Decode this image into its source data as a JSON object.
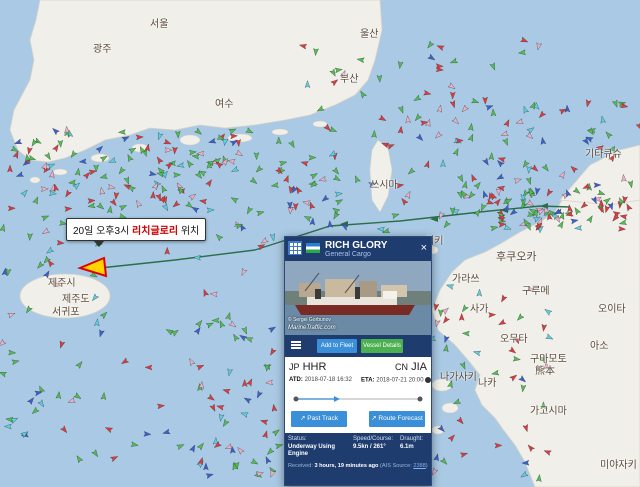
{
  "map": {
    "labels": [
      {
        "id": "gwangju",
        "text": "광주"
      },
      {
        "id": "seoul",
        "text": "서울"
      },
      {
        "id": "busan",
        "text": "부산"
      },
      {
        "id": "ulsan",
        "text": "울산"
      },
      {
        "id": "yeosu",
        "text": "여수"
      },
      {
        "id": "jeju",
        "text": "제주도"
      },
      {
        "id": "seogwipo",
        "text": "서귀포"
      },
      {
        "id": "jejusi",
        "text": "제주시"
      },
      {
        "id": "fukuoka",
        "text": "후쿠오카"
      },
      {
        "id": "kumamoto_ko",
        "text": "구마모토"
      },
      {
        "id": "kumamoto_jp",
        "text": "熊本"
      },
      {
        "id": "miyazaki",
        "text": "미야자키"
      },
      {
        "id": "nagasaki",
        "text": "나가사키"
      },
      {
        "id": "saga",
        "text": "사가"
      },
      {
        "id": "karatsu",
        "text": "가라쓰"
      },
      {
        "id": "kitakyushu",
        "text": "기타큐슈"
      },
      {
        "id": "oita",
        "text": "오이타"
      },
      {
        "id": "kagoshima",
        "text": "가고시마"
      },
      {
        "id": "kurume",
        "text": "구루메"
      },
      {
        "id": "omuta",
        "text": "오무타"
      },
      {
        "id": "naka",
        "text": "나카"
      },
      {
        "id": "iki",
        "text": "이키"
      },
      {
        "id": "aso",
        "text": "아소"
      },
      {
        "id": "tsushima",
        "text": "쓰시마"
      }
    ]
  },
  "callout": {
    "prefix": "20일 오후3시 ",
    "ship": "리치글로리",
    "suffix": " 위치"
  },
  "panel": {
    "vessel_name": "RICH GLORY",
    "vessel_type": "General Cargo",
    "close_icon": "×",
    "photo_credit": "© Sergei Gorbunov",
    "photo_site": "MarineTraffic.com",
    "add_fleet": "Add to Fleet",
    "vessel_details": "Vessel Details",
    "from_country": "JP",
    "from_port": "HHR",
    "to_country": "CN",
    "to_port": "JIA",
    "atd_label": "ATD:",
    "atd_value": "2018-07-18 16:32",
    "eta_label": "ETA:",
    "eta_value": "2018-07-21 20:00",
    "progress": 0.33,
    "past_track": "Past Track",
    "route_forecast": "Route Forecast",
    "status_label": "Status:",
    "status_value": "Underway Using Engine",
    "speed_label": "Speed/Course:",
    "speed_value": "9.5kn / 261°",
    "draught_label": "Draught:",
    "draught_value": "6.1m",
    "received_label": "Received:",
    "received_value": "3 hours, 19 minutes ago",
    "ais_source_label": "(AIS Source:",
    "ais_source_value": "2388",
    "ais_source_close": ")"
  },
  "colors": {
    "sea": "#a9c9e4",
    "land": "#f0efe9",
    "panel_navy": "#1f3c6e",
    "button_blue": "#3a8fd8",
    "button_green": "#4caf50",
    "vessel_cargo": "#4ec04e",
    "vessel_tanker": "#e0393e",
    "vessel_passenger": "#3a5fd0",
    "vessel_fishing": "#f0b0c8",
    "vessel_tug": "#5ad0e0",
    "track_line": "#2a6e4a",
    "selected_ship": "#ffd400"
  }
}
